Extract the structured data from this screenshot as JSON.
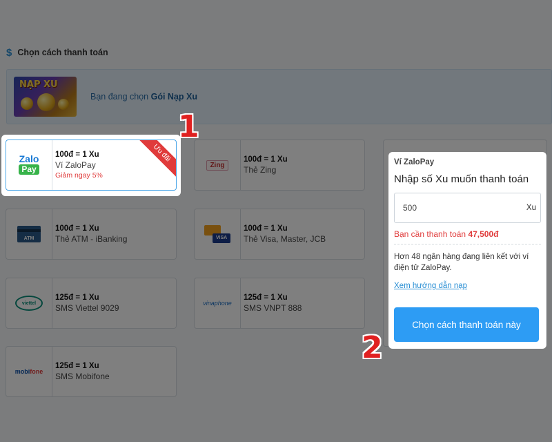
{
  "header": {
    "icon": "dollar-icon",
    "title": "Chọn cách thanh toán"
  },
  "banner": {
    "image_logo_text": "NẠP XU",
    "text_prefix": "Bạn đang chọn",
    "package": "Gói Nạp Xu"
  },
  "methods": [
    {
      "rate": "100đ = 1 Xu",
      "name": "Ví ZaloPay",
      "discount": "Giảm ngay 5%",
      "ribbon": "Ưu đãi",
      "logo": "zalopay-logo",
      "logo_text": [
        "Zalo",
        "Pay"
      ],
      "selected": true
    },
    {
      "rate": "100đ = 1 Xu",
      "name": "Thẻ Zing",
      "logo": "zing-logo",
      "logo_text": "Zing"
    },
    {
      "rate": "100đ = 1 Xu",
      "name": "Thẻ ATM - iBanking",
      "logo": "atm-card-logo",
      "logo_text": "ATM"
    },
    {
      "rate": "100đ = 1 Xu",
      "name": "Thẻ Visa, Master, JCB",
      "logo": "visa-master-logo",
      "logo_text": "VISA"
    },
    {
      "rate": "125đ = 1 Xu",
      "name": "SMS Viettel 9029",
      "logo": "viettel-logo",
      "logo_text": "viettel"
    },
    {
      "rate": "125đ = 1 Xu",
      "name": "SMS VNPT 888",
      "logo": "vinaphone-logo",
      "logo_text": "vinaphone"
    },
    {
      "rate": "125đ = 1 Xu",
      "name": "SMS Mobifone",
      "logo": "mobifone-logo",
      "logo_text": [
        "mobi",
        "fone"
      ]
    }
  ],
  "panel": {
    "provider": "Ví ZaloPay",
    "heading": "Nhập số Xu muốn thanh toán",
    "amount_value": "500",
    "amount_unit": "Xu",
    "pay_label": "Bạn cần thanh toán",
    "pay_amount": "47,500đ",
    "bank_info": "Hơn 48 ngân hàng đang liên kết với ví điện tử ZaloPay.",
    "guide_link": "Xem hướng dẫn nạp",
    "button_label": "Chọn cách thanh toán này"
  },
  "step_markers": [
    "1",
    "2"
  ],
  "colors": {
    "accent": "#2d9cf4",
    "ribbon": "#e03b3b",
    "marker": "#e02020"
  }
}
